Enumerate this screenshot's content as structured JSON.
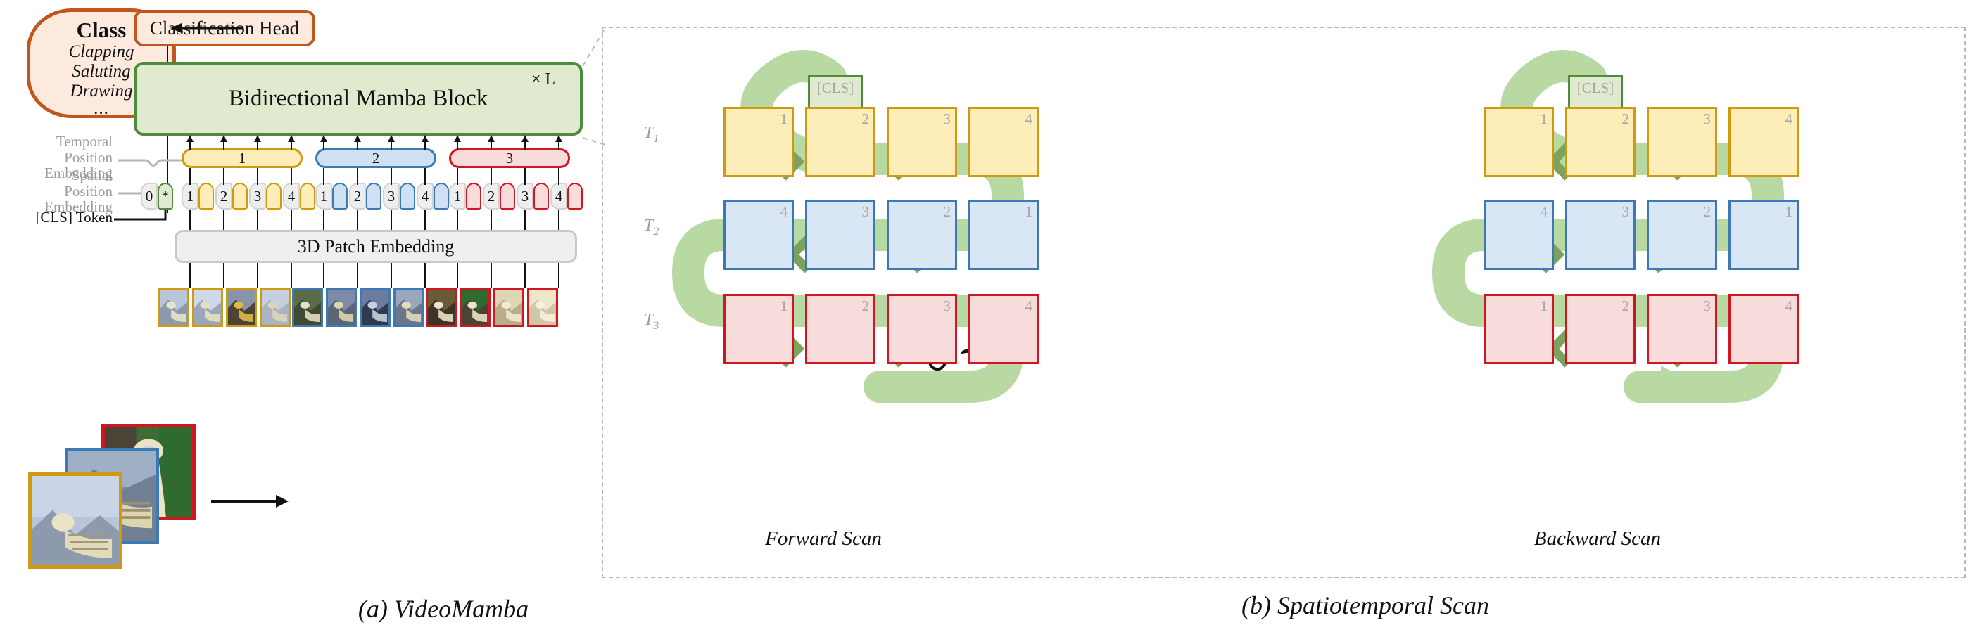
{
  "figure": {
    "caption_a": "(a) VideoMamba",
    "caption_b": "(b) Spatiotemporal Scan"
  },
  "panel_a": {
    "class_box": {
      "title": "Class",
      "items": [
        "Clapping",
        "Saluting",
        "Drawing"
      ],
      "ellipsis": "..."
    },
    "classification_head": "Classification Head",
    "mamba_block": {
      "label": "Bidirectional Mamba Block",
      "repeat": "× L"
    },
    "patch_embedding": "3D Patch Embedding",
    "labels": {
      "temporal_pos_embed_line1": "Temporal",
      "temporal_pos_embed_line2": "Position Embedding",
      "spatial_pos_embed_line1": "Spatial",
      "spatial_pos_embed_line2": "Position Embedding",
      "cls_token": "[CLS] Token"
    },
    "temporal_pills": [
      {
        "label": "1",
        "color": "#cf9a10"
      },
      {
        "label": "2",
        "color": "#3d7ab5"
      },
      {
        "label": "3",
        "color": "#cf1722"
      }
    ],
    "cls_token_symbols": {
      "index": "0",
      "star": "*"
    },
    "token_groups": [
      {
        "group": "1",
        "color": "#cf9a10",
        "tokens": [
          "1",
          "2",
          "3",
          "4"
        ]
      },
      {
        "group": "2",
        "color": "#3d7ab5",
        "tokens": [
          "1",
          "2",
          "3",
          "4"
        ]
      },
      {
        "group": "3",
        "color": "#cf1722",
        "tokens": [
          "1",
          "2",
          "3",
          "4"
        ]
      }
    ],
    "input_frames": [
      {
        "border": "#cf1722"
      },
      {
        "border": "#3d7ab5"
      },
      {
        "border": "#cf9a10"
      }
    ]
  },
  "panel_b": {
    "scans": [
      {
        "name": "Forward Scan",
        "cls_label": "[CLS]",
        "rows": [
          {
            "time": "T",
            "sub": "1",
            "color": "yellow",
            "cells": [
              "1",
              "2",
              "3",
              "4"
            ],
            "direction": "right"
          },
          {
            "time": "T",
            "sub": "2",
            "color": "blue",
            "cells": [
              "4",
              "3",
              "2",
              "1"
            ],
            "direction": "left"
          },
          {
            "time": "T",
            "sub": "3",
            "color": "red",
            "cells": [
              "1",
              "2",
              "3",
              "4"
            ],
            "direction": "right"
          }
        ],
        "head_at": "end"
      },
      {
        "name": "Backward Scan",
        "cls_label": "[CLS]",
        "rows": [
          {
            "time": "T",
            "sub": "1",
            "color": "yellow",
            "cells": [
              "1",
              "2",
              "3",
              "4"
            ],
            "direction": "left"
          },
          {
            "time": "T",
            "sub": "2",
            "color": "blue",
            "cells": [
              "4",
              "3",
              "2",
              "1"
            ],
            "direction": "right"
          },
          {
            "time": "T",
            "sub": "3",
            "color": "red",
            "cells": [
              "1",
              "2",
              "3",
              "4"
            ],
            "direction": "left"
          }
        ],
        "head_at": "cls"
      }
    ],
    "colors": {
      "snake_body": "#b9d9a3",
      "snake_chevron": "#7ba35e",
      "yellow_border": "#cf9a10",
      "yellow_fill": "#fdeeb9",
      "blue_border": "#3d7ab5",
      "blue_fill": "#d9e6f5",
      "red_border": "#cf1722",
      "red_fill": "#f8dcdc",
      "cls_border": "#4e8b3c",
      "cls_fill": "#dfeacf"
    }
  }
}
